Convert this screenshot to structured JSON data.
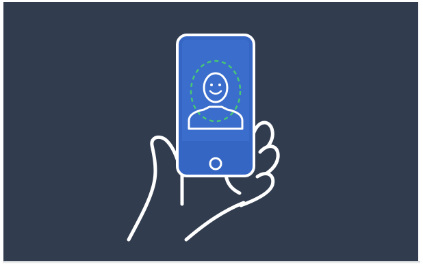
{
  "illustration": {
    "subject": "phone-face-recognition",
    "icons": [
      "hand-icon",
      "smartphone-icon",
      "face-scan-icon",
      "home-button-icon"
    ],
    "colors": {
      "background": "#313c4f",
      "phone_screen": "#3566c4",
      "phone_bezel": "#ffffff",
      "outline": "#ffffff",
      "scan_ring": "#48c774"
    }
  }
}
